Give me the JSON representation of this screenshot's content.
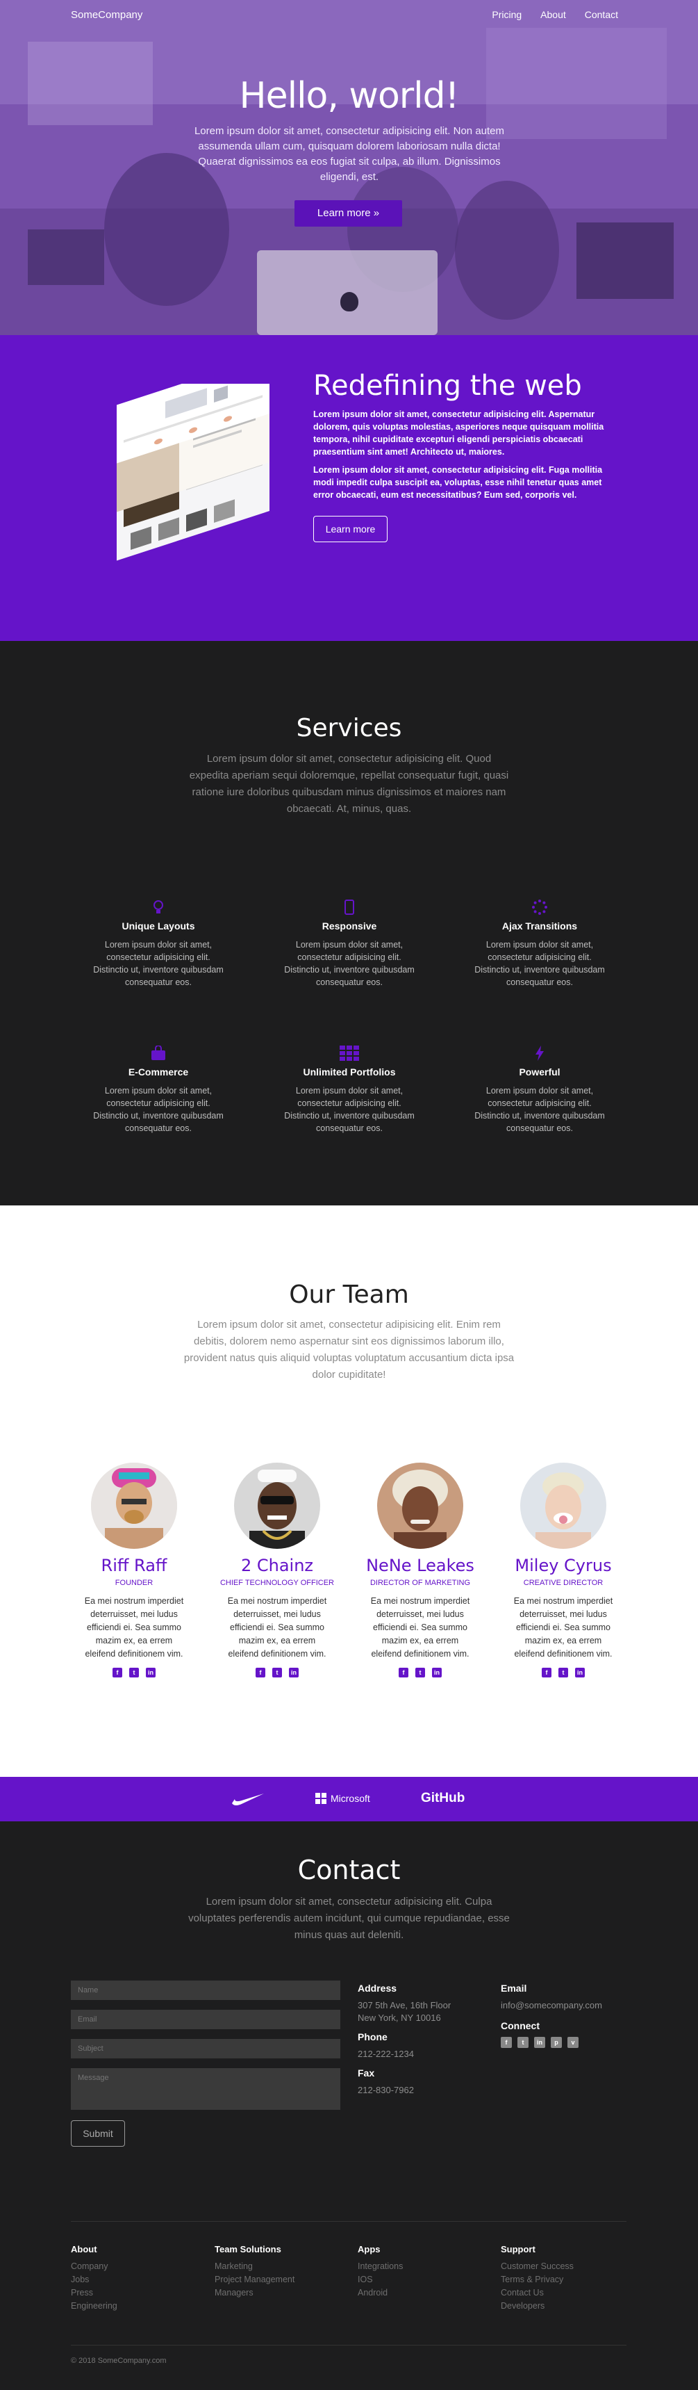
{
  "nav": {
    "brand": "SomeCompany",
    "links": [
      "Pricing",
      "About",
      "Contact"
    ]
  },
  "hero": {
    "title": "Hello, world!",
    "text": "Lorem ipsum dolor sit amet, consectetur adipisicing elit. Non autem assumenda ullam cum, quisquam dolorem laboriosam nulla dicta! Quaerat dignissimos ea eos fugiat sit culpa, ab illum. Dignissimos eligendi, est.",
    "button": "Learn more »"
  },
  "redefining": {
    "title": "Redefining the web",
    "p1": "Lorem ipsum dolor sit amet, consectetur adipisicing elit. Aspernatur dolorem, quis voluptas molestias, asperiores neque quisquam mollitia tempora, nihil cupiditate excepturi eligendi perspiciatis obcaecati praesentium sint amet! Architecto ut, maiores.",
    "p2": "Lorem ipsum dolor sit amet, consectetur adipisicing elit. Fuga mollitia modi impedit culpa suscipit ea, voluptas, esse nihil tenetur quas amet error obcaecati, eum est necessitatibus? Eum sed, corporis vel.",
    "button": "Learn more"
  },
  "services": {
    "title": "Services",
    "lead": "Lorem ipsum dolor sit amet, consectetur adipisicing elit. Quod expedita aperiam sequi doloremque, repellat consequatur fugit, quasi ratione iure doloribus quibusdam minus dignissimos et maiores nam obcaecati. At, minus, quas.",
    "items": [
      {
        "title": "Unique Layouts",
        "icon": "lightbulb-icon",
        "text": "Lorem ipsum dolor sit amet, consectetur adipisicing elit. Distinctio ut, inventore quibusdam consequatur eos."
      },
      {
        "title": "Responsive",
        "icon": "mobile-icon",
        "text": "Lorem ipsum dolor sit amet, consectetur adipisicing elit. Distinctio ut, inventore quibusdam consequatur eos."
      },
      {
        "title": "Ajax Transitions",
        "icon": "spinner-icon",
        "text": "Lorem ipsum dolor sit amet, consectetur adipisicing elit. Distinctio ut, inventore quibusdam consequatur eos."
      },
      {
        "title": "E-Commerce",
        "icon": "shopping-bag-icon",
        "text": "Lorem ipsum dolor sit amet, consectetur adipisicing elit. Distinctio ut, inventore quibusdam consequatur eos."
      },
      {
        "title": "Unlimited Portfolios",
        "icon": "grid-icon",
        "text": "Lorem ipsum dolor sit amet, consectetur adipisicing elit. Distinctio ut, inventore quibusdam consequatur eos."
      },
      {
        "title": "Powerful",
        "icon": "bolt-icon",
        "text": "Lorem ipsum dolor sit amet, consectetur adipisicing elit. Distinctio ut, inventore quibusdam consequatur eos."
      }
    ]
  },
  "team": {
    "title": "Our Team",
    "lead": "Lorem ipsum dolor sit amet, consectetur adipisicing elit. Enim rem debitis, dolorem nemo aspernatur sint eos dignissimos laborum illo, provident natus quis aliquid voluptas voluptatum accusantium dicta ipsa dolor cupiditate!",
    "members": [
      {
        "name": "Riff Raff",
        "role": "FOUNDER",
        "bio": "Ea mei nostrum imperdiet deterruisset, mei ludus efficiendi ei. Sea summo mazim ex, ea errem eleifend definitionem vim."
      },
      {
        "name": "2 Chainz",
        "role": "CHIEF TECHNOLOGY OFFICER",
        "bio": "Ea mei nostrum imperdiet deterruisset, mei ludus efficiendi ei. Sea summo mazim ex, ea errem eleifend definitionem vim."
      },
      {
        "name": "NeNe Leakes",
        "role": "DIRECTOR OF MARKETING",
        "bio": "Ea mei nostrum imperdiet deterruisset, mei ludus efficiendi ei. Sea summo mazim ex, ea errem eleifend definitionem vim."
      },
      {
        "name": "Miley Cyrus",
        "role": "CREATIVE DIRECTOR",
        "bio": "Ea mei nostrum imperdiet deterruisset, mei ludus efficiendi ei. Sea summo mazim ex, ea errem eleifend definitionem vim."
      }
    ]
  },
  "brands": {
    "microsoft": "Microsoft",
    "github": "GitHub"
  },
  "contact": {
    "title": "Contact",
    "lead": "Lorem ipsum dolor sit amet, consectetur adipisicing elit. Culpa voluptates perferendis autem incidunt, qui cumque repudiandae, esse minus quas aut deleniti.",
    "form": {
      "name": "Name",
      "email": "Email",
      "subject": "Subject",
      "message": "Message",
      "submit": "Submit"
    },
    "address_label": "Address",
    "address_line1": "307 5th Ave, 16th Floor",
    "address_line2": "New York, NY 10016",
    "phone_label": "Phone",
    "phone": "212-222-1234",
    "fax_label": "Fax",
    "fax": "212-830-7962",
    "email_label": "Email",
    "email": "info@somecompany.com",
    "connect_label": "Connect"
  },
  "footer": {
    "columns": [
      {
        "title": "About",
        "links": [
          "Company",
          "Jobs",
          "Press",
          "Engineering"
        ]
      },
      {
        "title": "Team Solutions",
        "links": [
          "Marketing",
          "Project Management",
          "Managers"
        ]
      },
      {
        "title": "Apps",
        "links": [
          "Integrations",
          "IOS",
          "Android"
        ]
      },
      {
        "title": "Support",
        "links": [
          "Customer Success",
          "Terms & Privacy",
          "Contact Us",
          "Developers"
        ]
      }
    ],
    "copyright": "© 2018 SomeCompany.com"
  },
  "colors": {
    "accent": "#6514c9",
    "dark": "#1d1d1e",
    "hero_overlay": "#7d52b4"
  }
}
